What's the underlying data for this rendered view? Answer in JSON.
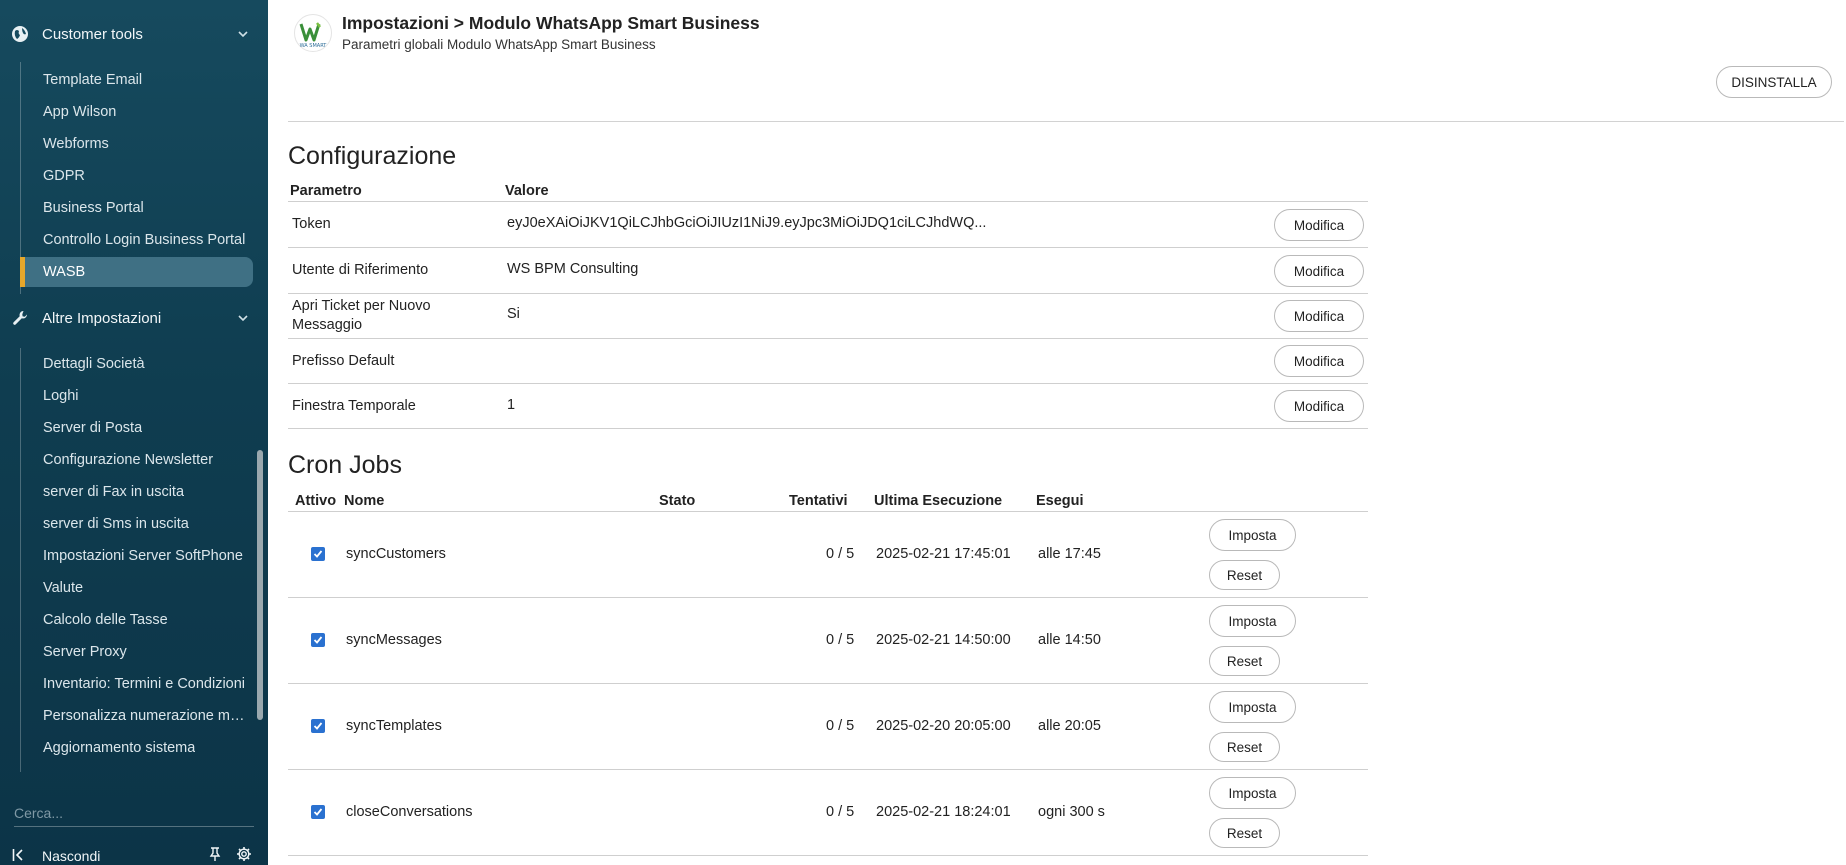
{
  "sidebar": {
    "section1": {
      "label": "Customer tools"
    },
    "items1": [
      {
        "label": "Template Email"
      },
      {
        "label": "App Wilson"
      },
      {
        "label": "Webforms"
      },
      {
        "label": "GDPR"
      },
      {
        "label": "Business Portal"
      },
      {
        "label": "Controllo Login Business Portal"
      },
      {
        "label": "WASB"
      }
    ],
    "section2": {
      "label": "Altre Impostazioni"
    },
    "items2": [
      {
        "label": "Dettagli Società"
      },
      {
        "label": "Loghi"
      },
      {
        "label": "Server di Posta"
      },
      {
        "label": "Configurazione Newsletter"
      },
      {
        "label": "server di Fax in uscita"
      },
      {
        "label": "server di Sms in uscita"
      },
      {
        "label": "Impostazioni Server SoftPhone"
      },
      {
        "label": "Valute"
      },
      {
        "label": "Calcolo delle Tasse"
      },
      {
        "label": "Server Proxy"
      },
      {
        "label": "Inventario: Termini e Condizioni"
      },
      {
        "label": "Personalizza numerazione moduli"
      },
      {
        "label": "Aggiornamento sistema"
      }
    ],
    "search_placeholder": "Cerca...",
    "hide_label": "Nascondi",
    "colors": {
      "active_accent": "#e6a72b"
    }
  },
  "header": {
    "title": "Impostazioni > Modulo WhatsApp Smart Business",
    "subtitle": "Parametri globali Modulo WhatsApp Smart Business",
    "logo_text": "WA SMART",
    "uninstall_label": "DISINSTALLA"
  },
  "config": {
    "title": "Configurazione",
    "col_param": "Parametro",
    "col_value": "Valore",
    "edit_label": "Modifica",
    "rows": [
      {
        "param": "Token",
        "value": "eyJ0eXAiOiJKV1QiLCJhbGciOiJIUzI1NiJ9.eyJpc3MiOiJDQ1ciLCJhdWQ..."
      },
      {
        "param": "Utente di Riferimento",
        "value": "WS BPM Consulting"
      },
      {
        "param": "Apri Ticket per Nuovo Messaggio",
        "value": "Si"
      },
      {
        "param": "Prefisso Default",
        "value": ""
      },
      {
        "param": "Finestra Temporale",
        "value": "1"
      }
    ]
  },
  "cron": {
    "title": "Cron Jobs",
    "headers": {
      "active": "Attivo",
      "name": "Nome",
      "status": "Stato",
      "attempts": "Tentativi",
      "last_run": "Ultima Esecuzione",
      "run": "Esegui"
    },
    "set_label": "Imposta",
    "reset_label": "Reset",
    "rows": [
      {
        "active": true,
        "name": "syncCustomers",
        "status": "",
        "attempts": "0 / 5",
        "last_run": "2025-02-21 17:45:01",
        "run": "alle 17:45"
      },
      {
        "active": true,
        "name": "syncMessages",
        "status": "",
        "attempts": "0 / 5",
        "last_run": "2025-02-21 14:50:00",
        "run": "alle 14:50"
      },
      {
        "active": true,
        "name": "syncTemplates",
        "status": "",
        "attempts": "0 / 5",
        "last_run": "2025-02-20 20:05:00",
        "run": "alle 20:05"
      },
      {
        "active": true,
        "name": "closeConversations",
        "status": "",
        "attempts": "0 / 5",
        "last_run": "2025-02-21 18:24:01",
        "run": "ogni 300 s"
      }
    ]
  }
}
